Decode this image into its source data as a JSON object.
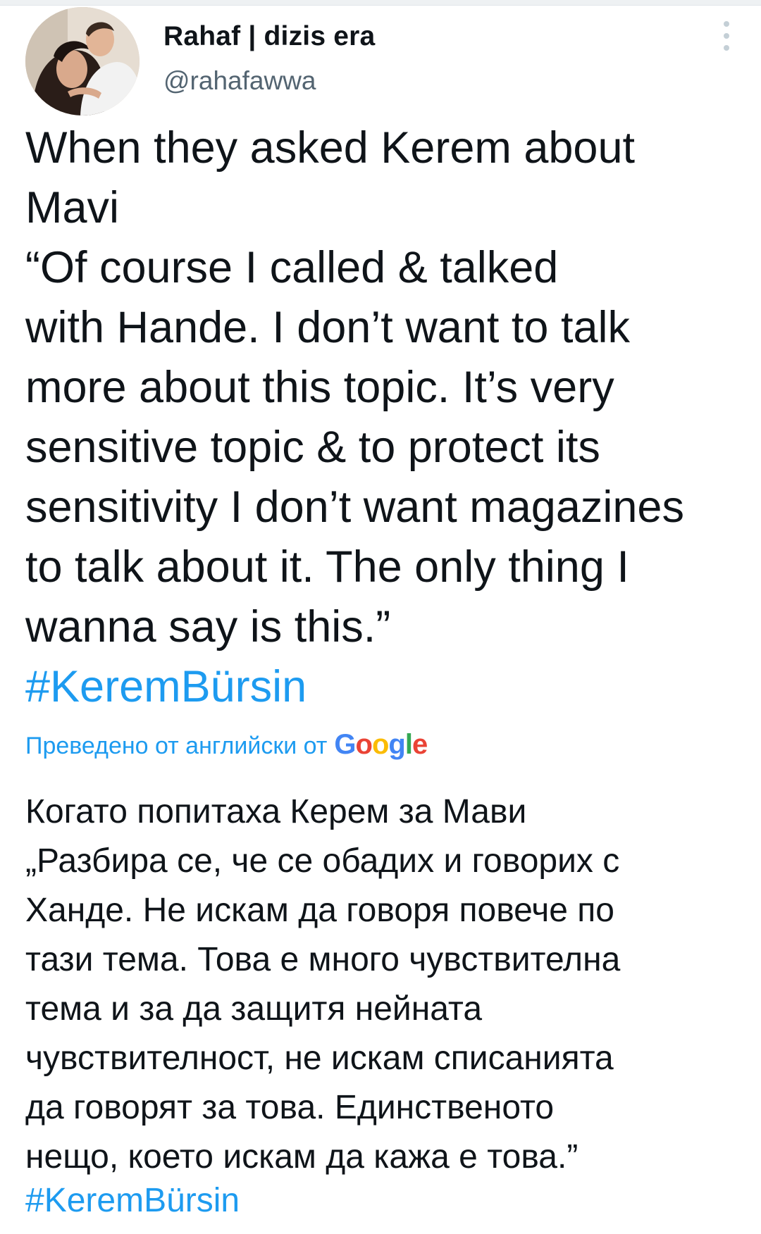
{
  "tweet": {
    "author_name": "Rahaf | dizis era",
    "author_handle": "@rahafawwa",
    "text": "When they asked Kerem about\nMavi\n“Of course I called & talked\nwith Hande. I don’t want to talk\nmore about this topic. It’s very\nsensitive topic & to protect its\nsensitivity I don’t want magazines\nto talk about it. The only thing I\nwanna say is this.”",
    "hashtag": "#KeremBürsin"
  },
  "translation": {
    "label": "Преведено от английски от",
    "provider_logo": "Google",
    "text": "Когато попитаха Керем за Мави\n„Разбира се, че се обадих и говорих с\nХанде. Не искам да говоря повече по\nтази тема. Това е много чувствителна\nтема и за да защитя нейната\nчувствителност, не искам списанията\nда говорят за това. Единственото\nнещо, което искам да кажа е това.”",
    "hashtag": "#KeremBürsin"
  },
  "colors": {
    "link": "#1d9bf0",
    "text": "#0f1419",
    "secondary_text": "#536471"
  },
  "icons": {
    "more": "more-vertical-icon"
  }
}
